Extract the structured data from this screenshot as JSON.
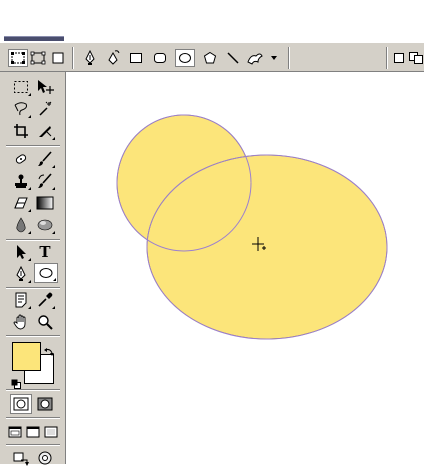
{
  "colors": {
    "foreground": "#fce57a",
    "background": "#ffffff",
    "shape_fill": "#fce57a",
    "path_stroke": "#9b7fd0",
    "chrome": "#d4d0c8"
  },
  "options_bar": {
    "items": [
      {
        "name": "shape-layers-icon",
        "pressed": true
      },
      {
        "name": "paths-mode-icon",
        "pressed": false
      },
      {
        "name": "fill-pixels-icon",
        "pressed": false
      },
      {
        "name": "pen-tool-icon",
        "pressed": false
      },
      {
        "name": "freeform-pen-icon",
        "pressed": false
      },
      {
        "name": "rectangle-shape-icon",
        "pressed": false
      },
      {
        "name": "rounded-rectangle-icon",
        "pressed": false
      },
      {
        "name": "ellipse-shape-icon",
        "pressed": true
      },
      {
        "name": "polygon-shape-icon",
        "pressed": false
      },
      {
        "name": "line-shape-icon",
        "pressed": false
      },
      {
        "name": "custom-shape-icon",
        "pressed": false
      }
    ]
  },
  "toolbox": {
    "type_tool_glyph": "T",
    "tools": [
      "marquee-tool-icon",
      "move-tool-icon",
      "lasso-tool-icon",
      "magic-wand-icon",
      "crop-tool-icon",
      "slice-tool-icon",
      "healing-brush-icon",
      "brush-tool-icon",
      "clone-stamp-icon",
      "history-brush-icon",
      "eraser-tool-icon",
      "gradient-tool-icon",
      "blur-tool-icon",
      "dodge-tool-icon",
      "path-selection-icon",
      "type-tool-icon",
      "pen-tool-icon",
      "ellipse-tool-icon",
      "notes-tool-icon",
      "eyedropper-icon",
      "hand-tool-icon",
      "zoom-tool-icon"
    ]
  }
}
